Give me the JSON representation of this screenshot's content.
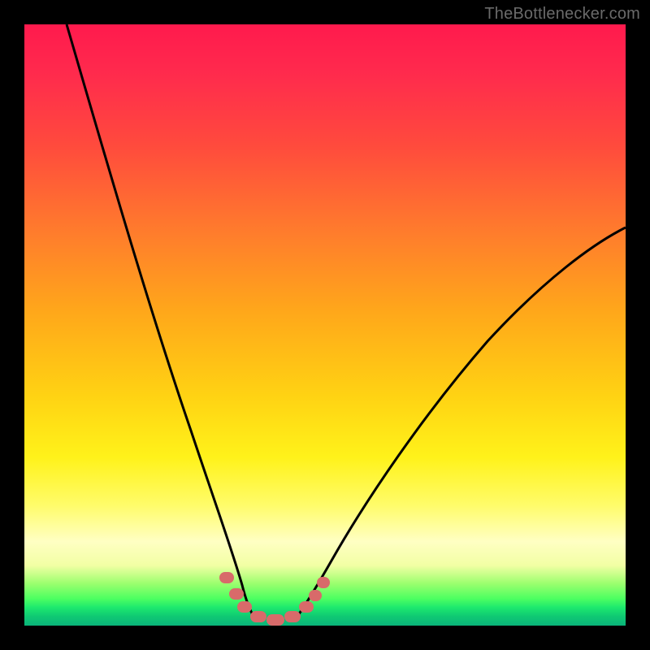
{
  "watermark": {
    "text": "TheBottlenecker.com"
  },
  "chart_data": {
    "type": "line",
    "title": "",
    "xlabel": "",
    "ylabel": "",
    "xlim": [
      0,
      100
    ],
    "ylim": [
      0,
      100
    ],
    "background_gradient_meaning": "vertical severity scale: top = high bottleneck (red), bottom = no bottleneck (green)",
    "series": [
      {
        "name": "left-branch",
        "x": [
          7,
          10,
          13,
          16,
          19,
          22,
          25,
          27,
          29,
          31,
          33,
          34.5,
          36,
          37
        ],
        "y": [
          100,
          88,
          76,
          64,
          53,
          43,
          33,
          26,
          20,
          14,
          9,
          5.5,
          3,
          1.5
        ]
      },
      {
        "name": "right-branch",
        "x": [
          45,
          46.5,
          48,
          50,
          53,
          57,
          62,
          68,
          75,
          82,
          89,
          96,
          100
        ],
        "y": [
          1.5,
          3,
          5,
          8,
          12,
          17,
          23,
          30,
          38,
          46,
          54,
          61,
          66
        ]
      },
      {
        "name": "bottleneck-markers",
        "type": "scatter",
        "marker": "pill",
        "color": "#d86a6a",
        "x": [
          33.5,
          35,
          36.5,
          38.5,
          41,
          43.5,
          45.5,
          47,
          48.5
        ],
        "y": [
          8,
          5,
          3,
          1.8,
          1.5,
          1.8,
          3.2,
          5.2,
          7.5
        ]
      }
    ],
    "annotations": []
  }
}
